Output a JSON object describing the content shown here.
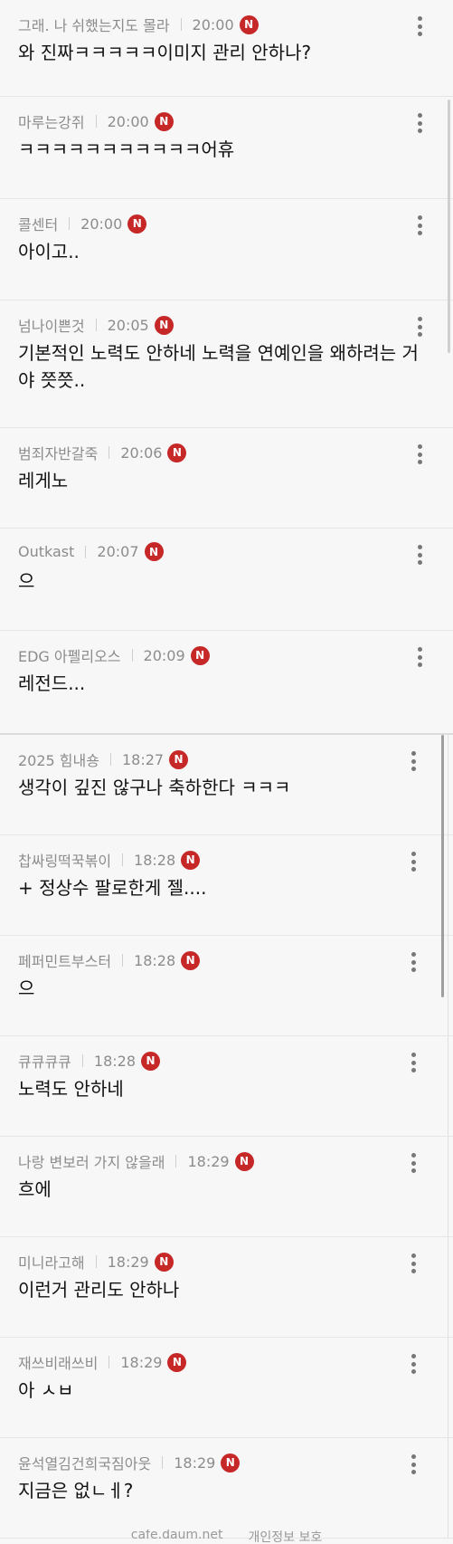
{
  "section1": {
    "comments": [
      {
        "author": "그래. 나 쉬했는지도 몰라",
        "time": "20:00",
        "badge": "N",
        "text": "와 진짜ㅋㅋㅋㅋㅋ이미지 관리 안하나?"
      },
      {
        "author": "마루는강쥐",
        "time": "20:00",
        "badge": "N",
        "text": "ㅋㅋㅋㅋㅋㅋㅋㅋㅋㅋㅋ어휴"
      },
      {
        "author": "콜센터",
        "time": "20:00",
        "badge": "N",
        "text": "아이고.."
      },
      {
        "author": "넘나이쁜것",
        "time": "20:05",
        "badge": "N",
        "text": "기본적인 노력도 안하네 노력을 연예인을 왜하려는 거야 쯧쯧.."
      },
      {
        "author": "범죄자반갈죽",
        "time": "20:06",
        "badge": "N",
        "text": "레게노"
      },
      {
        "author": "Outkast",
        "time": "20:07",
        "badge": "N",
        "text": "으"
      },
      {
        "author": "EDG 아펠리오스",
        "time": "20:09",
        "badge": "N",
        "text": "레전드..."
      }
    ]
  },
  "section2": {
    "comments": [
      {
        "author": "2025 힘내숑",
        "time": "18:27",
        "badge": "N",
        "text": "생각이 깊진 않구나 축하한다 ㅋㅋㅋ"
      },
      {
        "author": "찹싸링떡꾹볶이",
        "time": "18:28",
        "badge": "N",
        "text": "+ 정상수 팔로한게 젤...."
      },
      {
        "author": "페퍼민트부스터",
        "time": "18:28",
        "badge": "N",
        "text": "으"
      },
      {
        "author": "큐큐큐큐",
        "time": "18:28",
        "badge": "N",
        "text": "노력도 안하네"
      },
      {
        "author": "나랑 변보러 가지 않을래",
        "time": "18:29",
        "badge": "N",
        "text": "흐에"
      },
      {
        "author": "미니라고해",
        "time": "18:29",
        "badge": "N",
        "text": "이런거 관리도 안하나"
      },
      {
        "author": "재쓰비래쓰비",
        "time": "18:29",
        "badge": "N",
        "text": "아 ㅅㅂ"
      },
      {
        "author": "윤석열김건희국짐아웃",
        "time": "18:29",
        "badge": "N",
        "text": "지금은 없ㄴㅔ?"
      }
    ]
  },
  "footer": {
    "site": "cafe.daum.net",
    "privacy": "개인정보 보호"
  }
}
